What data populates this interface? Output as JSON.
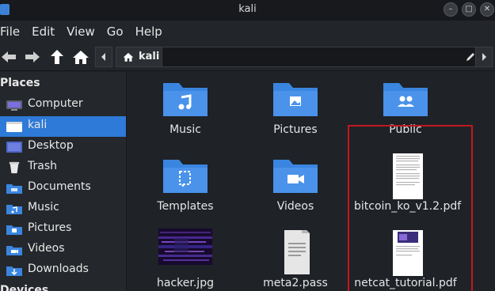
{
  "window": {
    "title": "kali"
  },
  "menu": {
    "items": [
      "File",
      "Edit",
      "View",
      "Go",
      "Help"
    ]
  },
  "toolbar": {
    "back_icon": "arrow-left-icon",
    "forward_icon": "arrow-right-icon",
    "up_icon": "arrow-up-icon",
    "home_icon": "home-icon",
    "path_crumb": "kali",
    "edit_icon": "pencil-icon"
  },
  "sidebar": {
    "header": "Places",
    "items": [
      {
        "label": "Computer",
        "icon": "computer-icon"
      },
      {
        "label": "kali",
        "icon": "home-folder-icon",
        "selected": true
      },
      {
        "label": "Desktop",
        "icon": "desktop-icon"
      },
      {
        "label": "Trash",
        "icon": "trash-icon"
      },
      {
        "label": "Documents",
        "icon": "documents-folder-icon"
      },
      {
        "label": "Music",
        "icon": "music-folder-icon"
      },
      {
        "label": "Pictures",
        "icon": "pictures-folder-icon"
      },
      {
        "label": "Videos",
        "icon": "videos-folder-icon"
      },
      {
        "label": "Downloads",
        "icon": "downloads-folder-icon"
      }
    ],
    "footer_header": "Devices"
  },
  "files": [
    {
      "name": "Music",
      "icon": "music-folder-icon"
    },
    {
      "name": "Pictures",
      "icon": "pictures-folder-icon"
    },
    {
      "name": "Public",
      "icon": "public-folder-icon"
    },
    {
      "name": "Templates",
      "icon": "templates-folder-icon"
    },
    {
      "name": "Videos",
      "icon": "videos-folder-icon"
    },
    {
      "name": "bitcoin_ko_v1.2.pdf",
      "icon": "pdf-thumbnail"
    },
    {
      "name": "hacker.jpg",
      "icon": "image-thumbnail"
    },
    {
      "name": "meta2.pass",
      "icon": "text-file-icon"
    },
    {
      "name": "netcat_tutorial.pdf",
      "icon": "pdf-thumbnail"
    }
  ],
  "colors": {
    "accent": "#2e7ad8",
    "folder": "#3a85e0",
    "highlight_box": "#c0191f"
  }
}
